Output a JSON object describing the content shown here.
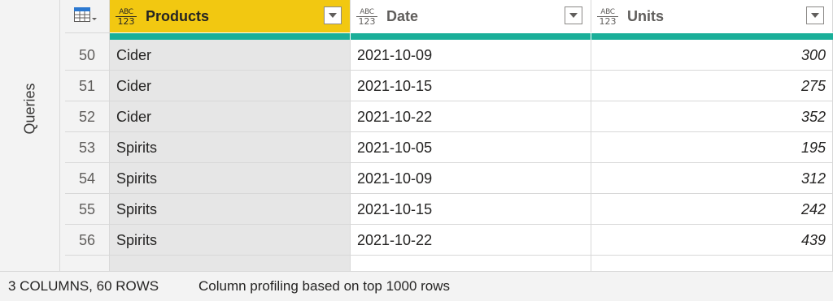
{
  "sidebar": {
    "label": "Queries"
  },
  "columns": [
    {
      "name": "Products",
      "type_top": "ABC",
      "type_bottom": "123",
      "selected": true
    },
    {
      "name": "Date",
      "type_top": "ABC",
      "type_bottom": "123",
      "selected": false
    },
    {
      "name": "Units",
      "type_top": "ABC",
      "type_bottom": "123",
      "selected": false
    }
  ],
  "rows": [
    {
      "num": "50",
      "product": "Cider",
      "date": "2021-10-09",
      "units": "300"
    },
    {
      "num": "51",
      "product": "Cider",
      "date": "2021-10-15",
      "units": "275"
    },
    {
      "num": "52",
      "product": "Cider",
      "date": "2021-10-22",
      "units": "352"
    },
    {
      "num": "53",
      "product": "Spirits",
      "date": "2021-10-05",
      "units": "195"
    },
    {
      "num": "54",
      "product": "Spirits",
      "date": "2021-10-09",
      "units": "312"
    },
    {
      "num": "55",
      "product": "Spirits",
      "date": "2021-10-15",
      "units": "242"
    },
    {
      "num": "56",
      "product": "Spirits",
      "date": "2021-10-22",
      "units": "439"
    }
  ],
  "status": {
    "summary": "3 COLUMNS, 60 ROWS",
    "profiling": "Column profiling based on top 1000 rows"
  },
  "colors": {
    "selected_header": "#f2c811",
    "quality_bar": "#1aaf99",
    "selected_column_bg": "#e6e6e6"
  }
}
